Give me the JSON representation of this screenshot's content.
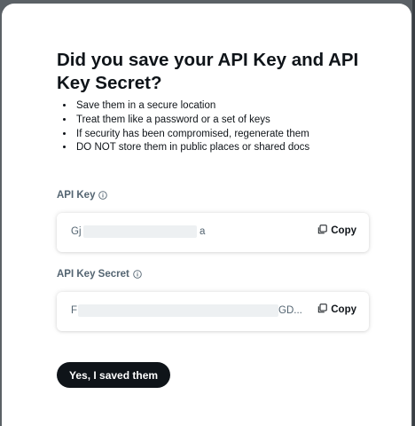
{
  "dialog": {
    "title": "Did you save your API Key and API Key Secret?",
    "bullets": [
      "Save them in a secure location",
      "Treat them like a password or a set of keys",
      "If security has been compromised, regenerate them",
      "DO NOT store them in public places or shared docs"
    ],
    "api_key": {
      "label": "API Key",
      "value_start": "Gj",
      "value_end": "a",
      "copy_label": "Copy"
    },
    "api_key_secret": {
      "label": "API Key Secret",
      "value_start": "F",
      "value_end": "GD...",
      "copy_label": "Copy"
    },
    "confirm_label": "Yes, I saved them"
  },
  "icons": {
    "info": "info-circle-icon",
    "copy": "copy-icon"
  }
}
